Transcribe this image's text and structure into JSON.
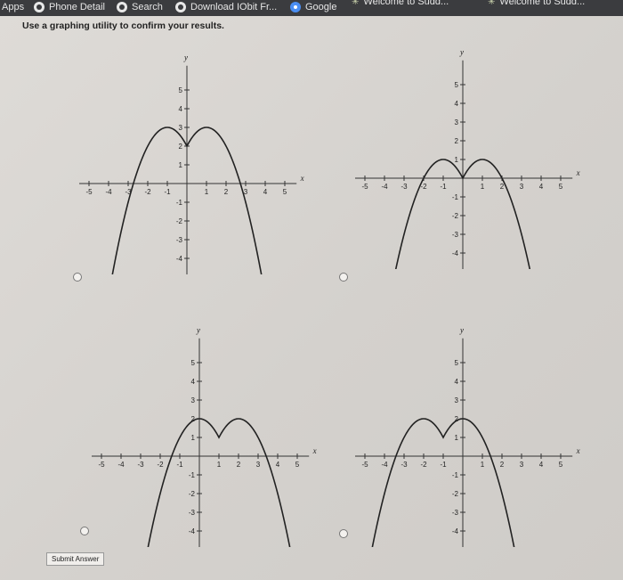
{
  "bookmarks": [
    {
      "label": "Apps",
      "icon": "apps-icon"
    },
    {
      "label": "Phone Detail",
      "icon": "globe-icon"
    },
    {
      "label": "Search",
      "icon": "globe-icon"
    },
    {
      "label": "Download IObit Fr...",
      "icon": "globe-icon"
    },
    {
      "label": "Google",
      "icon": "google-icon"
    },
    {
      "label": "Welcome to Sudd...",
      "icon": "star-icon"
    },
    {
      "label": "Welcome to Sudd...",
      "icon": "star-icon"
    }
  ],
  "instruction": "Use a graphing utility to confirm your results.",
  "submit_label": "Submit Answer",
  "axis_labels": {
    "x": "x",
    "y": "y"
  },
  "chart_data": [
    {
      "type": "line",
      "option": "A",
      "xlim": [
        -5.5,
        5.5
      ],
      "ylim": [
        -5.5,
        5.5
      ],
      "x_ticks": [
        "-5",
        "-4",
        "-3",
        "-2",
        "-1",
        "1",
        "2",
        "3",
        "4",
        "5"
      ],
      "y_ticks": [
        "5",
        "4",
        "3",
        "2",
        "1",
        "-1",
        "-2",
        "-3",
        "-4",
        "-5"
      ],
      "function": "y = 3 - (|x| - 1)^2 (peaks at (-1,3),(1,3); cusp at (0,2))"
    },
    {
      "type": "line",
      "option": "B",
      "xlim": [
        -5.5,
        5.5
      ],
      "ylim": [
        -5.5,
        5.5
      ],
      "x_ticks": [
        "-5",
        "-4",
        "-3",
        "-2",
        "-1",
        "1",
        "2",
        "3",
        "4",
        "5"
      ],
      "y_ticks": [
        "5",
        "4",
        "3",
        "2",
        "1",
        "-1",
        "-2",
        "-3",
        "-4",
        "-5"
      ],
      "function": "y = 1 - (|x| - 1)^2 (peaks at (-1,1),(1,1); cusp at (0,0))"
    },
    {
      "type": "line",
      "option": "C",
      "xlim": [
        -5.5,
        5.5
      ],
      "ylim": [
        -5.5,
        5.5
      ],
      "x_ticks": [
        "-5",
        "-4",
        "-3",
        "-2",
        "-1",
        "1",
        "2",
        "3",
        "4",
        "5"
      ],
      "y_ticks": [
        "5",
        "4",
        "3",
        "2",
        "1",
        "-1",
        "-2",
        "-3",
        "-4",
        "-5"
      ],
      "function": "y = 2 - (|x - 1| - 1)^2 (peaks at (0,2),(2,2); cusp at (1,1))"
    },
    {
      "type": "line",
      "option": "D",
      "xlim": [
        -5.5,
        5.5
      ],
      "ylim": [
        -5.5,
        5.5
      ],
      "x_ticks": [
        "-5",
        "-4",
        "-3",
        "-2",
        "-1",
        "1",
        "2",
        "3",
        "4",
        "5"
      ],
      "y_ticks": [
        "5",
        "4",
        "3",
        "2",
        "1",
        "-1",
        "-2",
        "-3",
        "-4",
        "-5"
      ],
      "function": "y = 2 - (|x + 1| - 1)^2 (peaks at (-2,2),(0,2); cusp at (-1,1))"
    }
  ]
}
